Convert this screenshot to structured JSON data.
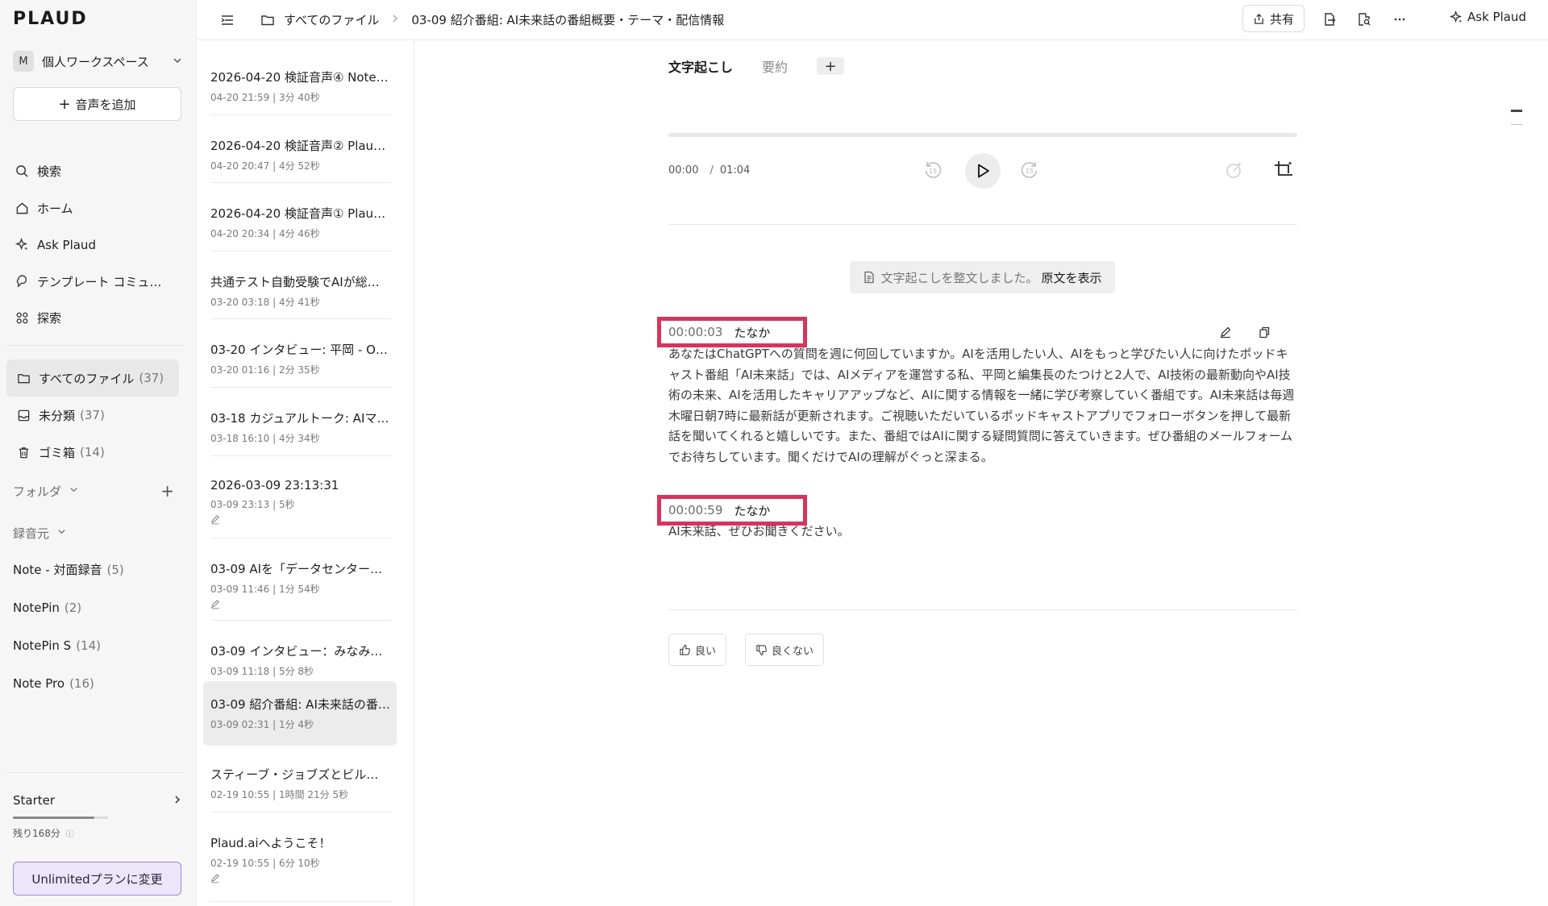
{
  "app": {
    "logo": "PLAUD"
  },
  "workspace": {
    "avatar": "M",
    "label": "個人ワークスペース"
  },
  "sidebar": {
    "add_audio": "音声を追加",
    "nav": [
      {
        "label": "検索",
        "icon": "search-icon"
      },
      {
        "label": "ホーム",
        "icon": "home-icon"
      },
      {
        "label": "Ask Plaud",
        "icon": "sparkle-icon"
      },
      {
        "label": "テンプレート コミュ…",
        "icon": "template-icon"
      },
      {
        "label": "探索",
        "icon": "explore-icon"
      }
    ],
    "files": [
      {
        "label": "すべてのファイル",
        "count": "(37)",
        "icon": "folder-icon"
      },
      {
        "label": "未分類",
        "count": "(37)",
        "icon": "inbox-icon"
      },
      {
        "label": "ゴミ箱",
        "count": "(14)",
        "icon": "trash-icon"
      }
    ],
    "folder_label": "フォルダ",
    "source_label": "録音元",
    "sources": [
      {
        "label": "Note - 対面録音",
        "count": "(5)"
      },
      {
        "label": "NotePin",
        "count": "(2)"
      },
      {
        "label": "NotePin S",
        "count": "(14)"
      },
      {
        "label": "Note Pro",
        "count": "(16)"
      }
    ],
    "plan": {
      "name": "Starter",
      "remaining": "残り168分",
      "usage_fraction": 0.86
    },
    "upgrade": "Unlimitedプランに変更"
  },
  "topbar": {
    "crumb_root": "すべてのファイル",
    "crumb_current": "03-09 紹介番組: AI未来話の番組概要・テーマ・配信情報",
    "share": "共有",
    "ask": "Ask Plaud"
  },
  "recordings": [
    {
      "title": "2026-04-20 検証音声④ Note …",
      "meta": "04-20 21:59 | 3分 40秒",
      "pen": false
    },
    {
      "title": "2026-04-20 検証音声② Plaud…",
      "meta": "04-20 20:47 | 4分 52秒",
      "pen": false
    },
    {
      "title": "2026-04-20 検証音声① Plaud…",
      "meta": "04-20 20:34 | 4分 46秒",
      "pen": false
    },
    {
      "title": "共通テスト自動受験でAIが総…",
      "meta": "03-20 03:18 | 4分 41秒",
      "pen": false
    },
    {
      "title": "03-20 インタビュー: 平岡 - O…",
      "meta": "03-20 01:16 | 2分 35秒",
      "pen": false
    },
    {
      "title": "03-18 カジュアルトーク: AIマ…",
      "meta": "03-18 16:10 | 4分 34秒",
      "pen": false
    },
    {
      "title": "2026-03-09 23:13:31",
      "meta": "03-09 23:13 | 5秒",
      "pen": true
    },
    {
      "title": "03-09 AIを「データセンター…",
      "meta": "03-09 11:46 | 1分 54秒",
      "pen": true
    },
    {
      "title": "03-09 インタビュー：みなみ…",
      "meta": "03-09 11:18 | 5分 8秒",
      "pen": false
    },
    {
      "title": "03-09 紹介番組: AI未来話の番…",
      "meta": "03-09 02:31 | 1分 4秒",
      "pen": false,
      "active": true
    },
    {
      "title": "スティーブ・ジョブズとビル…",
      "meta": "02-19 10:55 | 1時間 21分 5秒",
      "pen": false
    },
    {
      "title": "Plaud.aiへようこそ！",
      "meta": "02-19 10:55 | 6分 10秒",
      "pen": true
    }
  ],
  "main": {
    "tabs": [
      {
        "label": "文字起こし",
        "active": true
      },
      {
        "label": "要約",
        "active": false
      }
    ],
    "player": {
      "current": "00:00",
      "separator": "/",
      "total": "01:04"
    },
    "notice": {
      "message": "文字起こしを整文しました。",
      "link": "原文を表示"
    },
    "segments": [
      {
        "time": "00:00:03",
        "speaker": "たなか",
        "text": "あなたはChatGPTへの質問を週に何回していますか。AIを活用したい人、AIをもっと学びたい人に向けたポッドキャスト番組「AI未来話」では、AIメディアを運営する私、平岡と編集長のたつけと2人で、AI技術の最新動向やAI技術の未来、AIを活用したキャリアアップなど、AIに関する情報を一緒に学び考察していく番組です。AI未来話は毎週木曜日朝7時に最新話が更新されます。ご視聴いただいているポッドキャストアプリでフォローボタンを押して最新話を聞いてくれると嬉しいです。また、番組ではAIに関する疑問質問に答えていきます。ぜひ番組のメールフォームでお待ちしています。聞くだけでAIの理解がぐっと深まる。"
      },
      {
        "time": "00:00:59",
        "speaker": "たなか",
        "text": "AI未来話、ぜひお聞きください。"
      }
    ],
    "feedback": {
      "good": "良い",
      "bad": "良くない"
    }
  }
}
